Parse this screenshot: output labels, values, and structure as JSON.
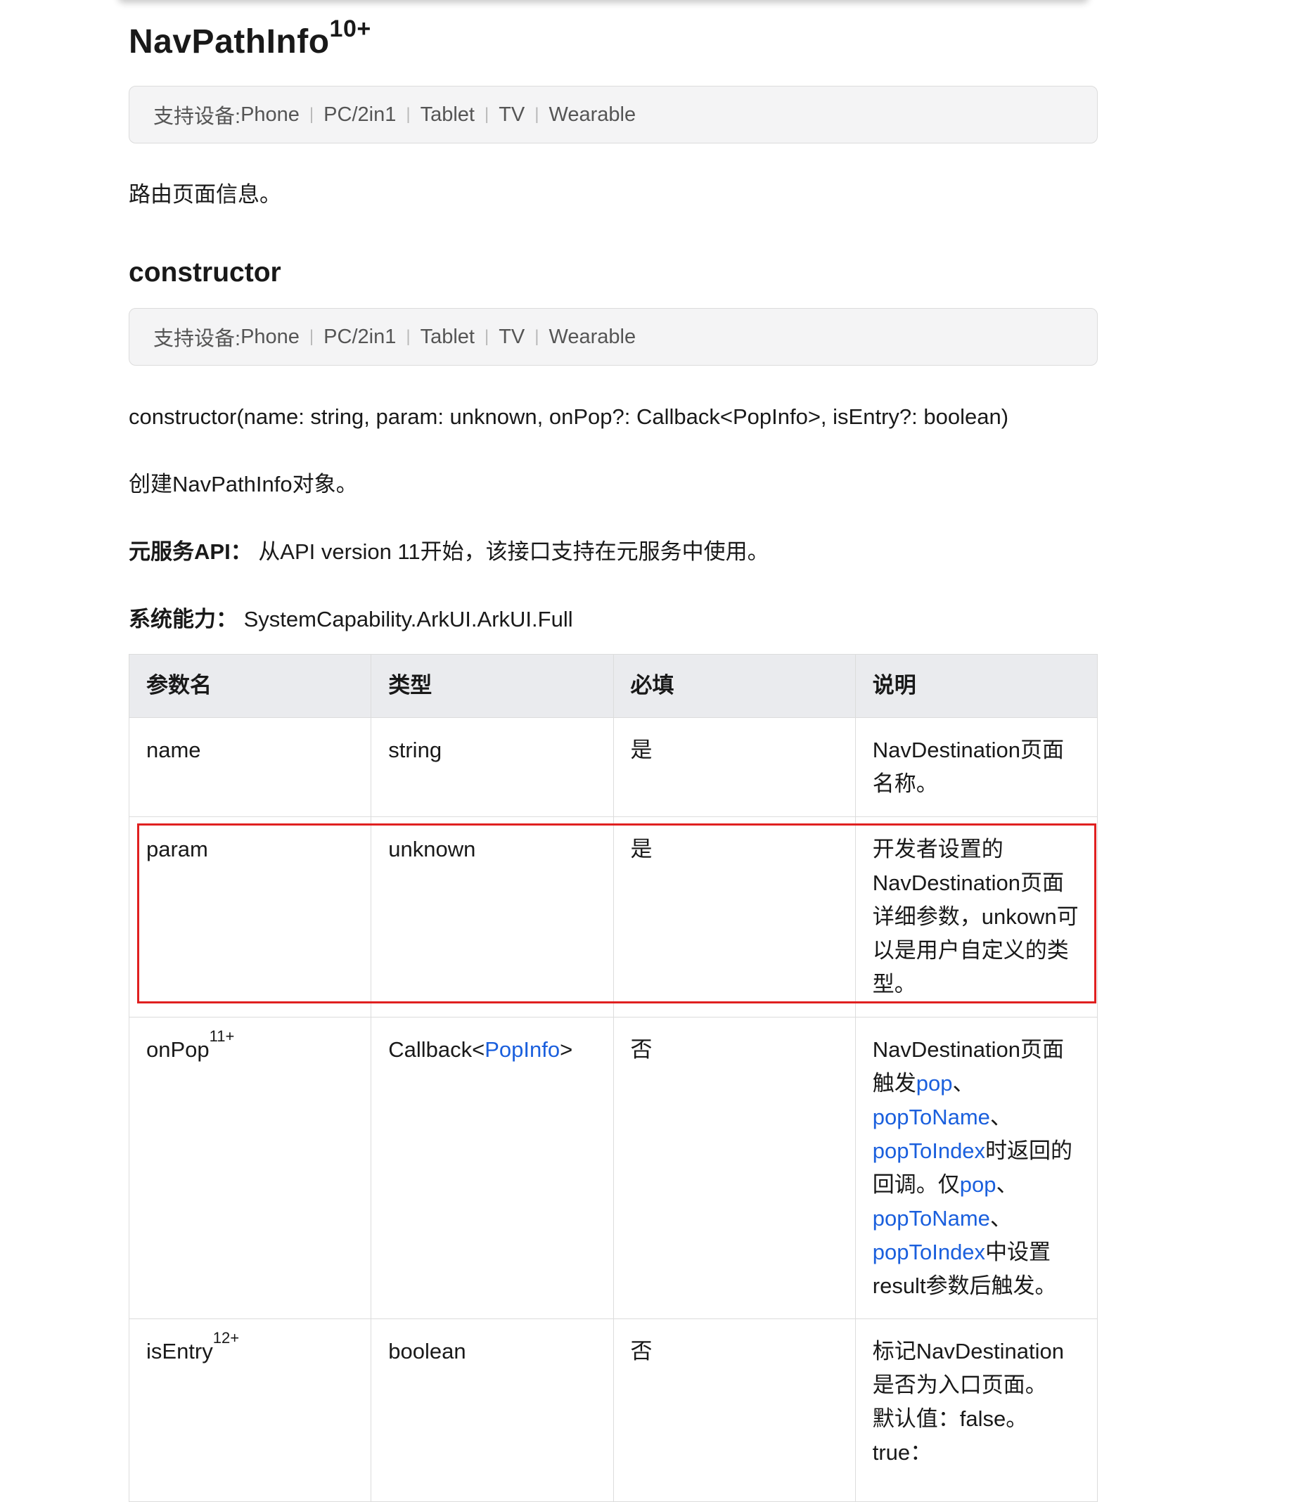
{
  "heading": {
    "title": "NavPathInfo",
    "version": "10+"
  },
  "devices": {
    "label": "支持设备: ",
    "items": [
      "Phone",
      "PC/2in1",
      "Tablet",
      "TV",
      "Wearable"
    ],
    "separator": "|"
  },
  "intro": "路由页面信息。",
  "constructor_section": {
    "title": "constructor",
    "signature": "constructor(name: string, param: unknown, onPop?: Callback<PopInfo>, isEntry?: boolean)",
    "description": "创建NavPathInfo对象。",
    "atomic_label": "元服务API：",
    "atomic_value": "从API version 11开始，该接口支持在元服务中使用。",
    "syscap_label": "系统能力：",
    "syscap_value": "SystemCapability.ArkUI.ArkUI.Full"
  },
  "table": {
    "headers": [
      "参数名",
      "类型",
      "必填",
      "说明"
    ],
    "rows": [
      {
        "name": "name",
        "sup": "",
        "type": "string",
        "required": "是",
        "desc": "NavDestination页面名称。"
      },
      {
        "name": "param",
        "sup": "",
        "type": "unknown",
        "required": "是",
        "desc": "开发者设置的NavDestination页面详细参数，unkown可以是用户自定义的类型。"
      },
      {
        "name": "onPop",
        "sup": "11+",
        "type_prefix": "Callback<",
        "type_link": "PopInfo",
        "type_suffix": ">",
        "required": "否",
        "desc_parts": [
          "NavDestination页面触发",
          "pop",
          "、",
          "popToName",
          "、",
          "popToIndex",
          "时返回的回调。仅",
          "pop",
          "、",
          "popToName",
          "、",
          "popToIndex",
          "中设置result参数后触发。"
        ]
      },
      {
        "name": "isEntry",
        "sup": "12+",
        "type": "boolean",
        "required": "否",
        "desc": "标记NavDestination是否为入口页面。",
        "desc_default": "默认值：false。",
        "desc_true": "true："
      }
    ]
  },
  "colors": {
    "link": "#1a5fdd",
    "highlight_border": "#e02020",
    "header_bg": "#eaebee"
  }
}
